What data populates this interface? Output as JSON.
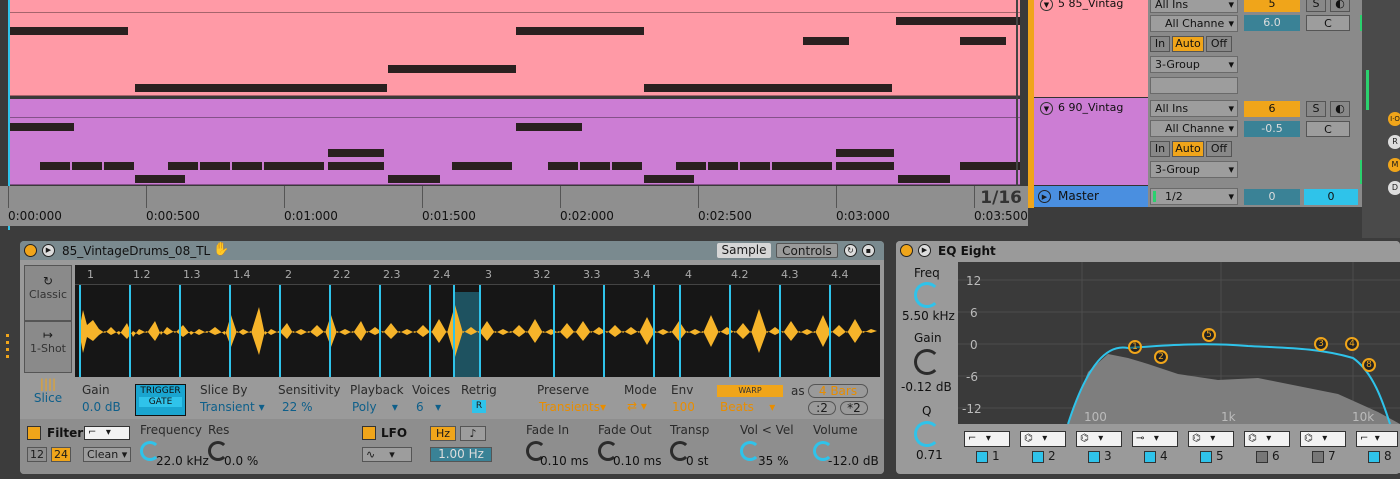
{
  "arrangement": {
    "timeline_labels": [
      "0:00:000",
      "0:00:500",
      "0:01:000",
      "0:01:500",
      "0:02:000",
      "0:02:500",
      "0:03:000",
      "0:03:500"
    ],
    "loop_marker": "1/16"
  },
  "tracks": [
    {
      "name": "5 85_Vintag",
      "input": "All Ins",
      "channel": "All Channe",
      "monitor": [
        "In",
        "Auto",
        "Off"
      ],
      "output": "3-Group",
      "number": "5",
      "solo": "S",
      "volume": "6.0",
      "pan": "C",
      "color": "#ff9aa6"
    },
    {
      "name": "6 90_Vintag",
      "input": "All Ins",
      "channel": "All Channe",
      "monitor": [
        "In",
        "Auto",
        "Off"
      ],
      "output": "3-Group",
      "number": "6",
      "solo": "S",
      "volume": "-0.5",
      "pan": "C",
      "color": "#cc7dd4"
    }
  ],
  "master": {
    "name": "Master",
    "output": "1/2",
    "volume": "0",
    "pan": "0"
  },
  "simpler": {
    "title": "85_VintageDrums_08_TL",
    "tabs": [
      "Sample",
      "Controls"
    ],
    "modes": [
      "Classic",
      "1-Shot",
      "Slice"
    ],
    "ruler": [
      "1",
      "1.2",
      "1.3",
      "1.4",
      "2",
      "2.2",
      "2.3",
      "2.4",
      "3",
      "3.2",
      "3.3",
      "3.4",
      "4",
      "4.2",
      "4.3",
      "4.4"
    ],
    "gain_label": "Gain",
    "gain": "0.0 dB",
    "trigger": "TRIGGER",
    "gate": "GATE",
    "sliceby_label": "Slice By",
    "sliceby": "Transient",
    "sens_label": "Sensitivity",
    "sens": "22 %",
    "playback_label": "Playback",
    "playback": "Poly",
    "voices_label": "Voices",
    "voices": "6",
    "retrig_label": "Retrig",
    "retrig": "R",
    "preserve_label": "Preserve",
    "preserve": "Transients",
    "mode_label": "Mode",
    "mode": "⇄",
    "env_label": "Env",
    "env": "100",
    "warp": "WARP",
    "warp_mode": "Beats",
    "as_label": "as",
    "bars": "4 Bars",
    "half": ":2",
    "double": "*2",
    "filter_label": "Filter",
    "filter_poles": [
      "12",
      "24"
    ],
    "filter_type": "Clean",
    "freq_label": "Frequency",
    "freq": "22.0 kHz",
    "res_label": "Res",
    "res": "0.0 %",
    "lfo_label": "LFO",
    "lfo_hz": "Hz",
    "lfo_note": "♪",
    "lfo_rate": "1.00 Hz",
    "fadein_label": "Fade In",
    "fadein": "0.10 ms",
    "fadeout_label": "Fade Out",
    "fadeout": "0.10 ms",
    "transp_label": "Transp",
    "transp": "0 st",
    "volvel_label": "Vol < Vel",
    "volvel": "35 %",
    "volume_label": "Volume",
    "volume": "-12.0 dB"
  },
  "eq": {
    "title": "EQ Eight",
    "freq_label": "Freq",
    "freq": "5.50 kHz",
    "gain_label": "Gain",
    "gain": "-0.12 dB",
    "q_label": "Q",
    "q": "0.71",
    "db_labels": [
      "12",
      "6",
      "0",
      "-6",
      "-12"
    ],
    "hz_labels": [
      "100",
      "1k",
      "10k"
    ],
    "bands": [
      "1",
      "2",
      "3",
      "4",
      "5",
      "6",
      "7",
      "8"
    ]
  },
  "side_buttons": [
    "I·O",
    "R",
    "M",
    "D"
  ]
}
